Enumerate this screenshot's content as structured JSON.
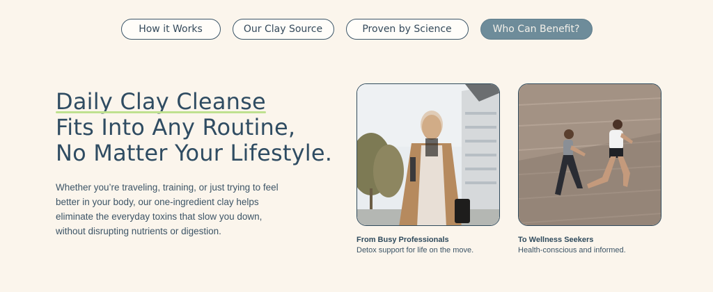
{
  "tabs": [
    {
      "label": "How it Works",
      "active": false
    },
    {
      "label": "Our Clay Source",
      "active": false
    },
    {
      "label": "Proven by Science",
      "active": false
    },
    {
      "label": "Who Can Benefit?",
      "active": true
    }
  ],
  "hero": {
    "headline_line1": "Daily Clay Cleanse",
    "headline_line2": "Fits Into Any Routine,",
    "headline_line3": "No Matter Your Lifestyle.",
    "body": "Whether you’re traveling, training, or just trying to feel better in your body, our one-ingredient clay helps eliminate the everyday toxins that slow you down, without disrupting nutrients or digestion."
  },
  "cards": [
    {
      "title": "From Busy Professionals",
      "description": "Detox support for life on the move."
    },
    {
      "title": "To Wellness Seekers",
      "description": "Health-conscious and informed."
    }
  ],
  "colors": {
    "background": "#fbf5ec",
    "text": "#2f4c62",
    "active_tab": "#6e8c9a",
    "highlight": "#bfe18f"
  }
}
